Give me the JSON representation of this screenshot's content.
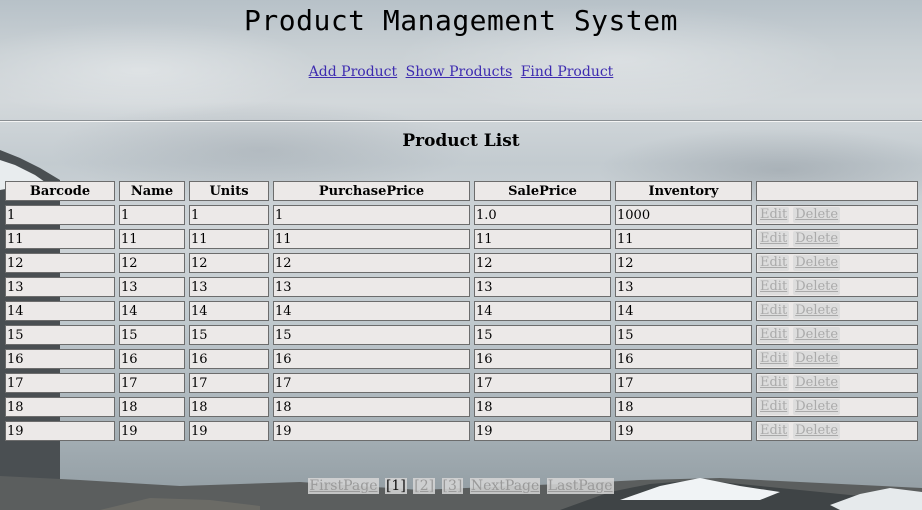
{
  "header": {
    "title": "Product Management System",
    "nav": [
      "Add Product",
      "Show Products",
      "Find Product"
    ]
  },
  "list": {
    "title": "Product List",
    "columns": [
      "Barcode",
      "Name",
      "Units",
      "PurchasePrice",
      "SalePrice",
      "Inventory",
      ""
    ],
    "actions": {
      "edit": "Edit",
      "delete": "Delete"
    },
    "rows": [
      [
        "1",
        "1",
        "1",
        "1",
        "1.0",
        "1000"
      ],
      [
        "11",
        "11",
        "11",
        "11",
        "11",
        "11"
      ],
      [
        "12",
        "12",
        "12",
        "12",
        "12",
        "12"
      ],
      [
        "13",
        "13",
        "13",
        "13",
        "13",
        "13"
      ],
      [
        "14",
        "14",
        "14",
        "14",
        "14",
        "14"
      ],
      [
        "15",
        "15",
        "15",
        "15",
        "15",
        "15"
      ],
      [
        "16",
        "16",
        "16",
        "16",
        "16",
        "16"
      ],
      [
        "17",
        "17",
        "17",
        "17",
        "17",
        "17"
      ],
      [
        "18",
        "18",
        "18",
        "18",
        "18",
        "18"
      ],
      [
        "19",
        "19",
        "19",
        "19",
        "19",
        "19"
      ]
    ]
  },
  "pager": {
    "first": "FirstPage",
    "pages": [
      "[1]",
      "[2]",
      "[3]"
    ],
    "current_index": 0,
    "next": "NextPage",
    "last": "LastPage"
  },
  "colors": {
    "link": "#3d2bb0",
    "cell_bg": "#ece9e8",
    "disabled_text": "#aaaaaa"
  },
  "icons": [
    "mountain-background-image"
  ]
}
